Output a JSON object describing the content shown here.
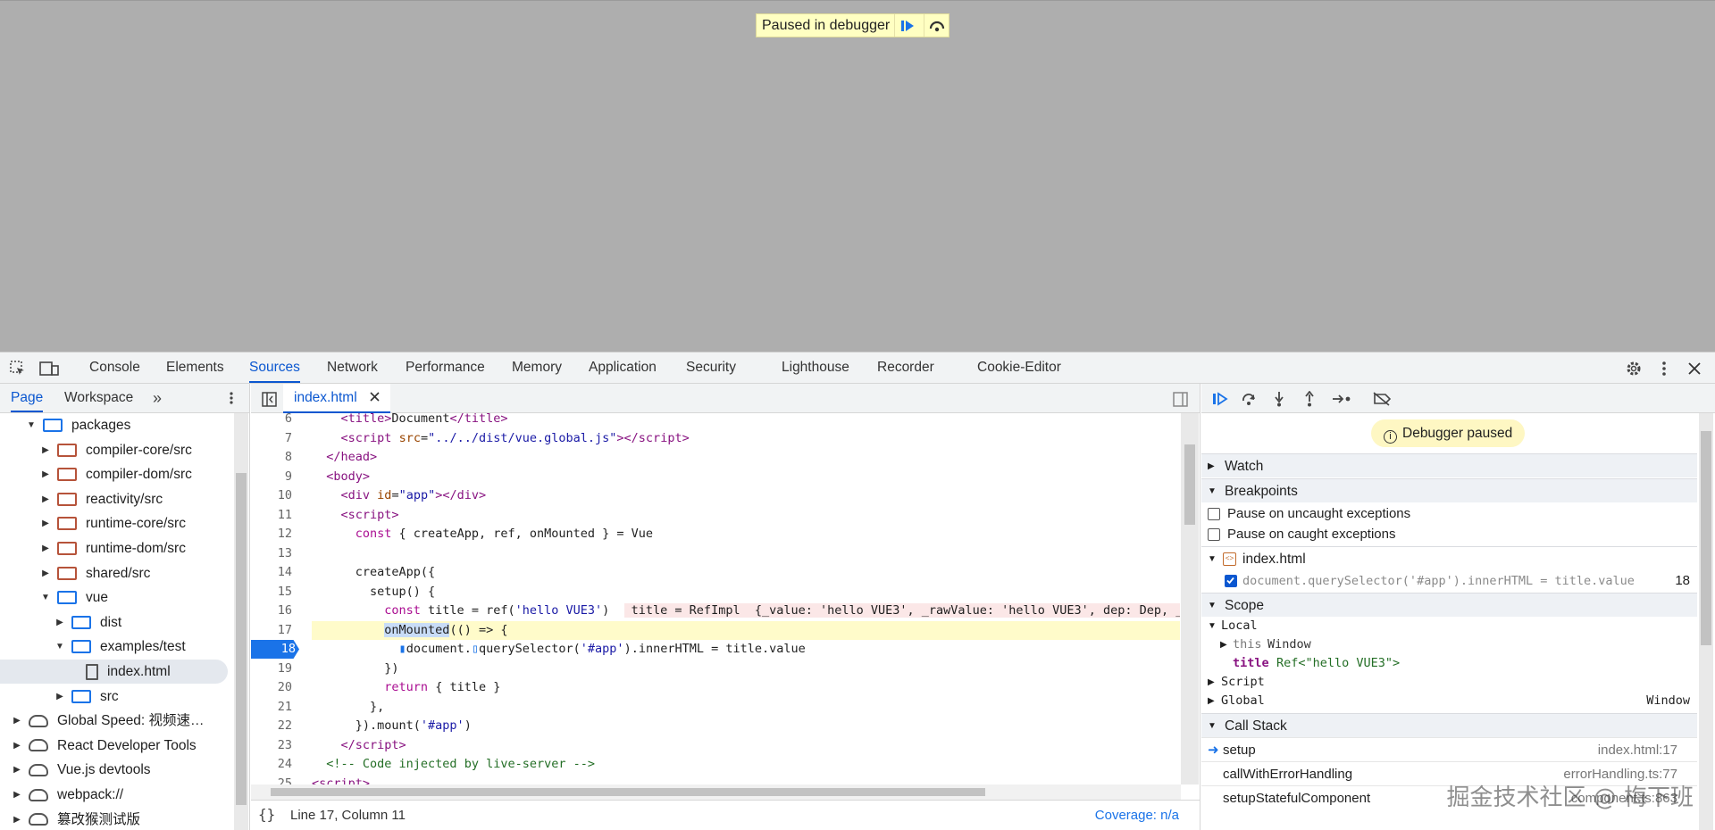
{
  "banner": {
    "text": "Paused in debugger"
  },
  "tabs": [
    "Console",
    "Elements",
    "Sources",
    "Network",
    "Performance",
    "Memory",
    "Application",
    "Security",
    "Lighthouse",
    "Recorder",
    "Cookie-Editor"
  ],
  "navigator": {
    "tabs": [
      "Page",
      "Workspace"
    ],
    "tree": [
      {
        "label": "packages",
        "icon": "folder-blue",
        "depth": 2,
        "state": "open"
      },
      {
        "label": "compiler-core/src",
        "icon": "folder",
        "depth": 3,
        "state": "closed"
      },
      {
        "label": "compiler-dom/src",
        "icon": "folder",
        "depth": 3,
        "state": "closed"
      },
      {
        "label": "reactivity/src",
        "icon": "folder",
        "depth": 3,
        "state": "closed"
      },
      {
        "label": "runtime-core/src",
        "icon": "folder",
        "depth": 3,
        "state": "closed"
      },
      {
        "label": "runtime-dom/src",
        "icon": "folder",
        "depth": 3,
        "state": "closed"
      },
      {
        "label": "shared/src",
        "icon": "folder",
        "depth": 3,
        "state": "closed"
      },
      {
        "label": "vue",
        "icon": "folder-blue",
        "depth": 3,
        "state": "open"
      },
      {
        "label": "dist",
        "icon": "folder-blue",
        "depth": 4,
        "state": "closed"
      },
      {
        "label": "examples/test",
        "icon": "folder-blue",
        "depth": 4,
        "state": "open"
      },
      {
        "label": "index.html",
        "icon": "file",
        "depth": 5,
        "state": "none",
        "selected": true
      },
      {
        "label": "src",
        "icon": "folder-blue",
        "depth": 4,
        "state": "closed"
      },
      {
        "label": "Global Speed: 视频速…",
        "icon": "cloud",
        "depth": 1,
        "state": "closed"
      },
      {
        "label": "React Developer Tools",
        "icon": "cloud",
        "depth": 1,
        "state": "closed"
      },
      {
        "label": "Vue.js devtools",
        "icon": "cloud",
        "depth": 1,
        "state": "closed"
      },
      {
        "label": "webpack://",
        "icon": "cloud",
        "depth": 1,
        "state": "closed"
      },
      {
        "label": "篡改猴测试版",
        "icon": "cloud",
        "depth": 1,
        "state": "closed"
      }
    ]
  },
  "editor": {
    "file_tab": "index.html",
    "lines": [
      {
        "n": "6",
        "html": "    <span class='tag'>&lt;title&gt;</span>Document<span class='tag'>&lt;/title&gt;</span>"
      },
      {
        "n": "7",
        "html": "    <span class='tag'>&lt;script</span> <span class='attr'>src</span>=<span class='str'>\"../../dist/vue.global.js\"</span><span class='tag'>&gt;&lt;/script&gt;</span>"
      },
      {
        "n": "8",
        "html": "  <span class='tag'>&lt;/head&gt;</span>"
      },
      {
        "n": "9",
        "html": "  <span class='tag'>&lt;body&gt;</span>"
      },
      {
        "n": "10",
        "html": "    <span class='tag'>&lt;div</span> <span class='attr'>id</span>=<span class='str'>\"app\"</span><span class='tag'>&gt;&lt;/div&gt;</span>"
      },
      {
        "n": "11",
        "html": "    <span class='tag'>&lt;script&gt;</span>"
      },
      {
        "n": "12",
        "html": "      <span class='kw'>const</span> { createApp, ref, onMounted } = Vue"
      },
      {
        "n": "13",
        "html": ""
      },
      {
        "n": "14",
        "html": "      createApp({"
      },
      {
        "n": "15",
        "html": "        setup() {"
      },
      {
        "n": "16",
        "html": "          <span class='kw'>const</span> title = ref(<span class='str'>'hello VUE3'</span>)  <span class='inl'> title = RefImpl  {_value: 'hello VUE3', _rawValue: 'hello VUE3', dep: Dep, __v</span>"
      },
      {
        "n": "17",
        "html": "          <span style='background:#c8dcf7'>onMounted</span>(() =&gt; {",
        "hl": true
      },
      {
        "n": "18",
        "html": "            <span style='color:#1a73e8'>▮</span>document.<span style='color:#1a73e8'>▯</span>querySelector(<span class='str'>'#app'</span>).innerHTML = title.value",
        "bp": true
      },
      {
        "n": "19",
        "html": "          })"
      },
      {
        "n": "20",
        "html": "          <span class='kw'>return</span> { title }"
      },
      {
        "n": "21",
        "html": "        },"
      },
      {
        "n": "22",
        "html": "      }).mount(<span class='str'>'#app'</span>)"
      },
      {
        "n": "23",
        "html": "    <span class='tag'>&lt;/script&gt;</span>"
      },
      {
        "n": "24",
        "html": "  <span class='cm'>&lt;!-- Code injected by live-server --&gt;</span>"
      },
      {
        "n": "25",
        "html": "<span class='tag'>&lt;script&gt;</span>"
      }
    ],
    "status_position": "Line 17, Column 11",
    "coverage": "Coverage: n/a"
  },
  "debugger": {
    "paused_label": "Debugger paused",
    "watch": "Watch",
    "breakpoints": "Breakpoints",
    "pause_uncaught": "Pause on uncaught exceptions",
    "pause_caught": "Pause on caught exceptions",
    "bp_file": "index.html",
    "bp_code": "document.querySelector('#app').innerHTML = title.value",
    "bp_line": "18",
    "scope": "Scope",
    "local": "Local",
    "this_key": "this",
    "this_val": "Window",
    "title_key": "title",
    "title_val": "Ref<\"hello VUE3\">",
    "script": "Script",
    "global": "Global",
    "global_val": "Window",
    "call_stack": "Call Stack",
    "frames": [
      {
        "name": "setup",
        "loc": "index.html:17",
        "current": true
      },
      {
        "name": "callWithErrorHandling",
        "loc": "errorHandling.ts:77"
      },
      {
        "name": "setupStatefulComponent",
        "loc": "component.ts:863"
      }
    ]
  },
  "watermark": "掘金技术社区 @ 梅下班",
  "colors": {
    "accent": "#0b57d0",
    "breakpoint": "#1a73e8",
    "paused_bg": "#ffffc2"
  }
}
